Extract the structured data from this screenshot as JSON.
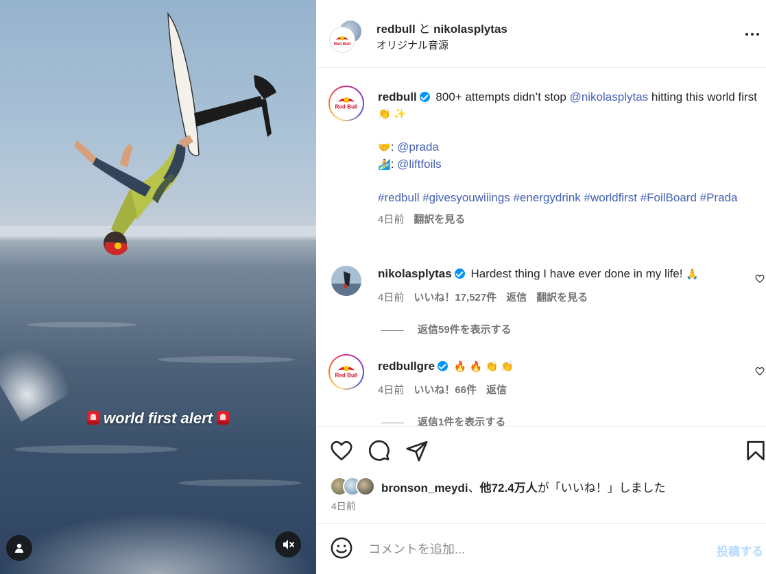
{
  "media": {
    "caption_text": "world first alert",
    "alarm_icon": "police-light-icon",
    "user_icon": "person-icon",
    "mute_icon": "speaker-muted-icon"
  },
  "header": {
    "username1": "redbull",
    "connector": "と",
    "username2": "nikolasplytas",
    "audio": "オリジナル音源",
    "avatar_label": "Red Bull"
  },
  "post": {
    "username": "redbull",
    "caption_pre": "800+ attempts didn’t stop ",
    "mention": "@nikolasplytas",
    "caption_post": " hitting this world first",
    "caption_emoji": "👏 ✨",
    "credit1_emoji": "🤝",
    "credit1": "@prada",
    "credit2_emoji": "🏄",
    "credit2": "@liftfoils",
    "hashtags": "#redbull #givesyouwiiings #energydrink #worldfirst #FoilBoard #Prada",
    "time": "4日前",
    "translate": "翻訳を見る"
  },
  "comments": [
    {
      "username": "nikolasplytas",
      "text": "Hardest thing I have ever done in my life!",
      "emoji": "🙏",
      "time": "4日前",
      "likes": "いいね！17,527件",
      "reply": "返信",
      "translate": "翻訳を見る",
      "view_replies": "返信59件を表示する"
    },
    {
      "username": "redbullgre",
      "text": "🔥 🔥 👏 👏",
      "time": "4日前",
      "likes": "いいね！66件",
      "reply": "返信",
      "view_replies": "返信1件を表示する"
    }
  ],
  "likes": {
    "first_user": "bronson_meydi",
    "separator": "、",
    "others": "他72.4万人",
    "suffix": "が「いいね！」しました"
  },
  "date": "4日前",
  "add_comment": {
    "placeholder": "コメントを追加...",
    "post_label": "投稿する"
  },
  "colors": {
    "link": "#4561b4",
    "verified": "#0095f6",
    "post_disabled": "#b3dbff",
    "muted_text": "#737373"
  }
}
